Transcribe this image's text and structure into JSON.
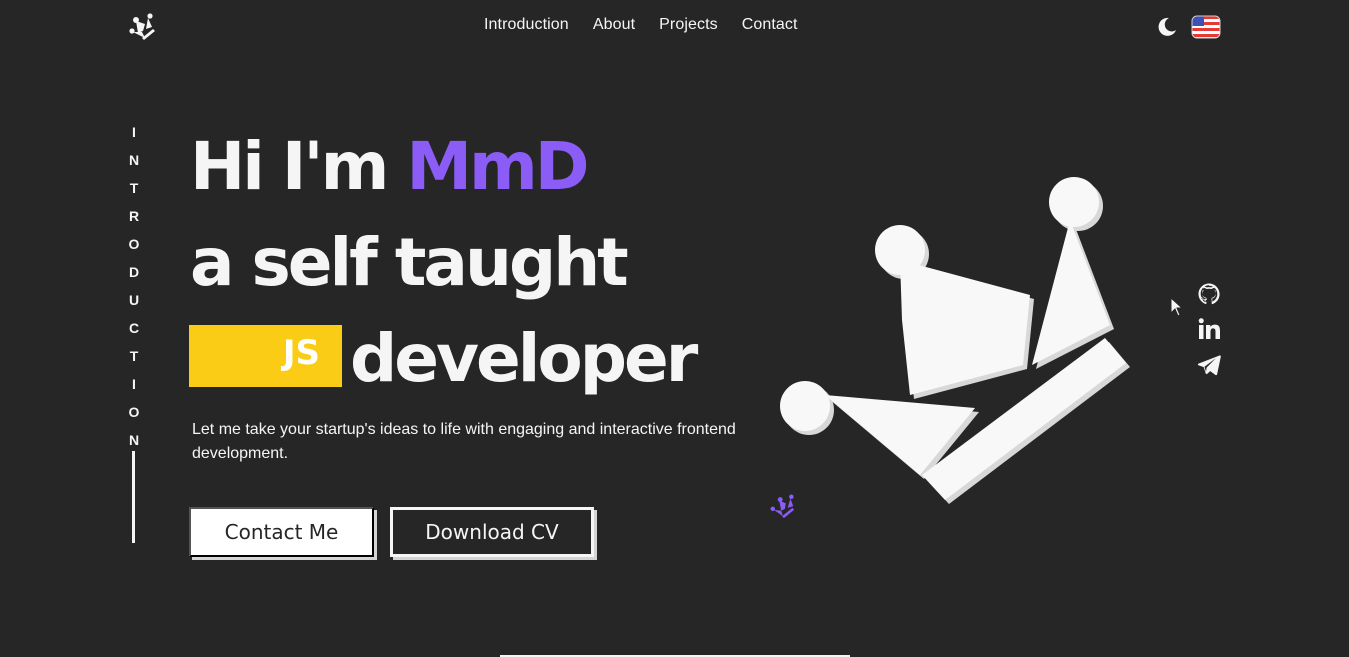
{
  "header": {
    "logo_icon": "crown-logo-icon",
    "nav": [
      {
        "label": "Introduction"
      },
      {
        "label": "About"
      },
      {
        "label": "Projects"
      },
      {
        "label": "Contact"
      }
    ],
    "theme_icon": "moon-icon",
    "language_icon": "us-flag-icon"
  },
  "side": {
    "label": "INTRODUCTION"
  },
  "hero": {
    "greeting": "Hi I'm ",
    "name": "MmD",
    "line2": "a self taught",
    "badge": "JS",
    "line3": "developer",
    "tagline": "Let me take your startup's ideas to life with engaging and interactive frontend development.",
    "contact_button": "Contact Me",
    "cv_button": "Download CV"
  },
  "social": [
    {
      "icon": "github-icon"
    },
    {
      "icon": "linkedin-icon"
    },
    {
      "icon": "telegram-icon"
    }
  ],
  "colors": {
    "background": "#262626",
    "accent": "#8b5cf6",
    "badge": "#facc15",
    "text": "#f5f5f5"
  }
}
